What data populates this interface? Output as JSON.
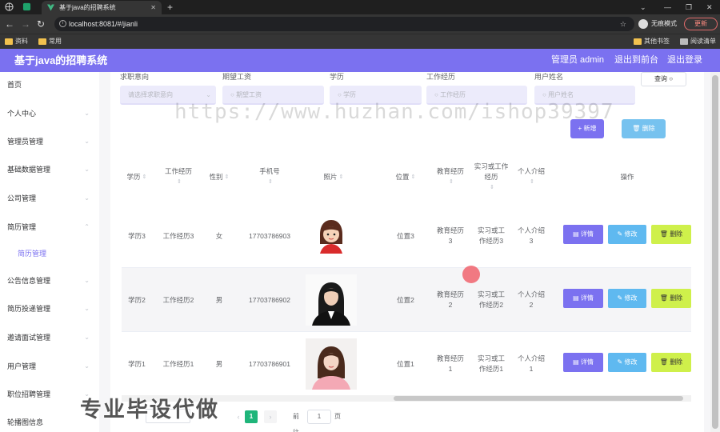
{
  "browser": {
    "tab_title": "基于java的招聘系统",
    "url": "localhost:8081/#/jianli",
    "profile_label": "无痕模式",
    "update_label": "更新",
    "bookmarks": [
      "资料",
      "常用"
    ],
    "bookmarks_right": [
      "其他书签",
      "阅读清单"
    ]
  },
  "header": {
    "title": "基于java的招聘系统",
    "user": "管理员 admin",
    "back_link": "退出到前台",
    "logout_link": "退出登录"
  },
  "sidebar": {
    "items": [
      {
        "label": "首页"
      },
      {
        "label": "个人中心"
      },
      {
        "label": "管理员管理"
      },
      {
        "label": "基础数据管理"
      },
      {
        "label": "公司管理"
      },
      {
        "label": "简历管理"
      },
      {
        "label": "简历管理"
      },
      {
        "label": "公告信息管理"
      },
      {
        "label": "简历投递管理"
      },
      {
        "label": "邀请面试管理"
      },
      {
        "label": "用户管理"
      },
      {
        "label": "职位招聘管理"
      },
      {
        "label": "轮播图信息"
      }
    ]
  },
  "search": {
    "fields": [
      {
        "label": "求职意向",
        "placeholder": "请选择求职意向"
      },
      {
        "label": "期望工资",
        "placeholder": "期望工资"
      },
      {
        "label": "学历",
        "placeholder": "学历"
      },
      {
        "label": "工作经历",
        "placeholder": "工作经历"
      },
      {
        "label": "用户姓名",
        "placeholder": "用户姓名"
      }
    ],
    "search_button": "查询"
  },
  "actions": {
    "add": "新增",
    "delete": "删除"
  },
  "table": {
    "headers": [
      "学历",
      "工作经历",
      "性别",
      "手机号",
      "照片",
      "位置",
      "教育经历",
      "实习或工作经历",
      "个人介绍",
      "操作"
    ],
    "rows": [
      {
        "degree": "学历3",
        "work": "工作经历3",
        "gender": "女",
        "phone": "17703786903",
        "location": "位置3",
        "education": "教育经历3",
        "intern": "实习或工作经历3",
        "intro": "个人介绍3"
      },
      {
        "degree": "学历2",
        "work": "工作经历2",
        "gender": "男",
        "phone": "17703786902",
        "location": "位置2",
        "education": "教育经历2",
        "intern": "实习或工作经历2",
        "intro": "个人介绍2"
      },
      {
        "degree": "学历1",
        "work": "工作经历1",
        "gender": "男",
        "phone": "17703786901",
        "location": "位置1",
        "education": "教育经历1",
        "intern": "实习或工作经历1",
        "intro": "个人介绍1"
      }
    ],
    "row_actions": {
      "detail": "详情",
      "edit": "修改",
      "remove": "删除"
    }
  },
  "pagination": {
    "current_page": "1",
    "goto_label": "前往",
    "goto_value": "1",
    "unit": "页"
  },
  "overlay": {
    "watermark": "https://www.huzhan.com/ishop39397",
    "promo": "专业毕设代做"
  },
  "colors": {
    "primary": "#7b71f0",
    "edit": "#5fb9f0",
    "remove": "#cff04b",
    "page_active": "#1fb57a"
  }
}
